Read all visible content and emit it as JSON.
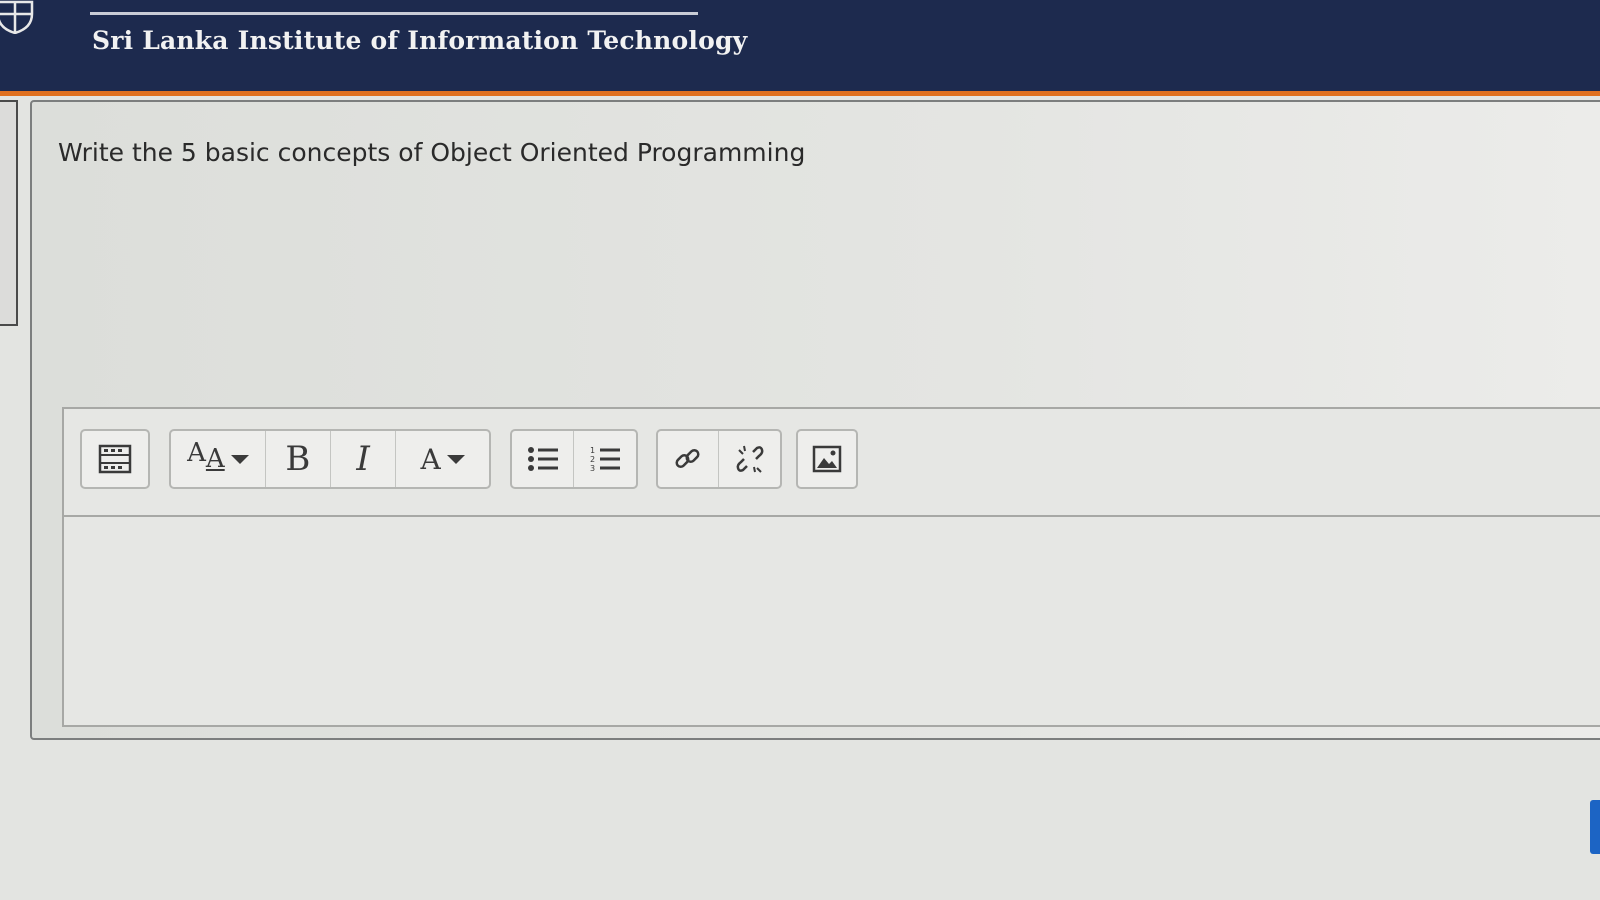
{
  "header": {
    "title": "Sri Lanka Institute of Information Technology",
    "bg_color": "#1d2a4e",
    "accent_color": "#e0701f"
  },
  "question": {
    "text": "Write the 5 basic concepts of Object Oriented Programming"
  },
  "editor": {
    "toolbar": {
      "groups": [
        {
          "name": "toggle-toolbar",
          "buttons": [
            {
              "icon": "toolbar-toggle-icon"
            }
          ]
        },
        {
          "name": "text-formatting",
          "buttons": [
            {
              "icon": "font-size-icon",
              "label": "AA"
            },
            {
              "icon": "bold-icon",
              "label": "B"
            },
            {
              "icon": "italic-icon",
              "label": "I"
            },
            {
              "icon": "font-color-icon",
              "label": "A"
            }
          ]
        },
        {
          "name": "lists",
          "buttons": [
            {
              "icon": "bullet-list-icon"
            },
            {
              "icon": "numbered-list-icon"
            }
          ]
        },
        {
          "name": "links",
          "buttons": [
            {
              "icon": "link-icon"
            },
            {
              "icon": "unlink-icon"
            }
          ]
        },
        {
          "name": "media",
          "buttons": [
            {
              "icon": "image-icon"
            }
          ]
        }
      ]
    },
    "value": ""
  }
}
